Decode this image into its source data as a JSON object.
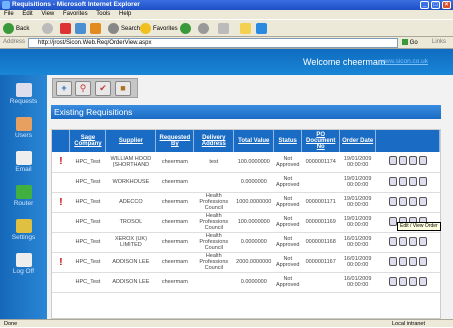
{
  "window": {
    "title": "Requisitions - Microsoft Internet Explorer"
  },
  "menu": [
    "File",
    "Edit",
    "View",
    "Favorites",
    "Tools",
    "Help"
  ],
  "toolbar": {
    "back": "Back",
    "search": "Search",
    "favorites": "Favorites"
  },
  "address": {
    "label": "Address",
    "url": "http://jrost/Sicon.Web.Req/OrderView.aspx",
    "go": "Go",
    "links": "Links"
  },
  "header": {
    "welcome": "Welcome cheermam",
    "site": "www.sicon.co.uk"
  },
  "nav": [
    "Requests",
    "Users",
    "Email",
    "Router",
    "Settings",
    "Log Off"
  ],
  "section": {
    "title": "Existing Requisitions"
  },
  "table": {
    "headers": [
      "Sage Company",
      "Supplier",
      "Requested By",
      "Delivery Address",
      "Total Value",
      "Status",
      "PO Document No",
      "Order Date"
    ],
    "rows": [
      {
        "flag": "!",
        "company": "HPC_Test",
        "supplier": "WILLIAM HOOD (SHORTHAND",
        "by": "cheermam",
        "address": "test",
        "total": "100.0000000",
        "status": "Not Approved",
        "po": "0000001174",
        "date": "19/01/2009 00:00:00"
      },
      {
        "flag": "",
        "company": "HPC_Test",
        "supplier": "WORKHOUSE",
        "by": "cheermam",
        "address": "",
        "total": "0.0000000",
        "status": "Not Approved",
        "po": "",
        "date": "19/01/2009 00:00:00"
      },
      {
        "flag": "!",
        "company": "HPC_Test",
        "supplier": "ADECCO",
        "by": "cheermam",
        "address": "Health Professions Council",
        "total": "1000.0000000",
        "status": "Not Approved",
        "po": "0000001171",
        "date": "19/01/2009 00:00:00"
      },
      {
        "flag": "",
        "company": "HPC_Test",
        "supplier": "TROSOL",
        "by": "cheermam",
        "address": "Health Professions Council",
        "total": "100.0000000",
        "status": "Not Approved",
        "po": "0000001169",
        "date": "19/01/2009 00:00:00"
      },
      {
        "flag": "",
        "company": "HPC_Test",
        "supplier": "XEROX (UK) LIMITED",
        "by": "cheermam",
        "address": "Health Professions Council",
        "total": "0.0000000",
        "status": "Not Approved",
        "po": "0000001168",
        "date": "16/01/2009 00:00:00"
      },
      {
        "flag": "!",
        "company": "HPC_Test",
        "supplier": "ADDISON LEE",
        "by": "cheermam",
        "address": "Health Professions Council",
        "total": "2000.0000000",
        "status": "Not Approved",
        "po": "0000001167",
        "date": "16/01/2009 00:00:00"
      },
      {
        "flag": "",
        "company": "HPC_Test",
        "supplier": "ADDISON LEE",
        "by": "cheermam",
        "address": "",
        "total": "0.0000000",
        "status": "Not Approved",
        "po": "",
        "date": "16/01/2009 00:00:00"
      }
    ]
  },
  "tooltip": "Edit / View Order",
  "status": {
    "left": "Done",
    "right": "Local intranet"
  }
}
